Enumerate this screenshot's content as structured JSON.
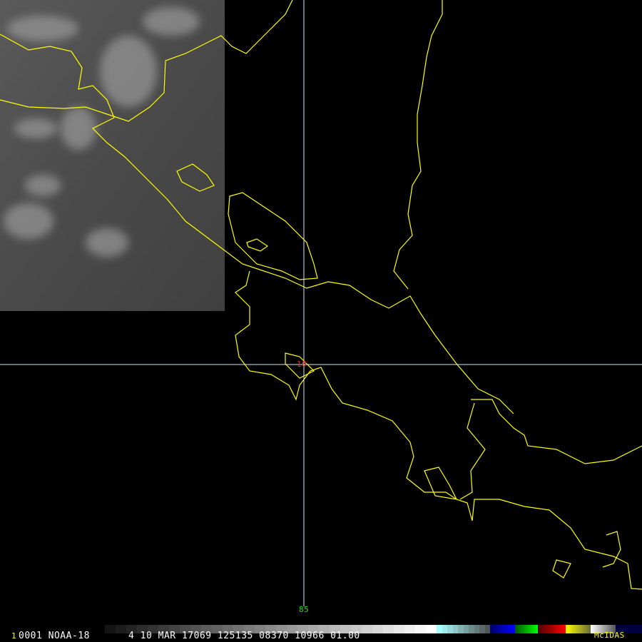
{
  "map": {
    "lat_label": "10",
    "lon_label": "85",
    "crosshair_color": "#cfe8ee",
    "coast_color": "#ffff00",
    "lat_label_color": "#ff2020",
    "lon_label_color": "#20e020"
  },
  "status_bar": {
    "frame": "1",
    "info": "0001 NOAA-18",
    "details": "4 10 MAR 17069 125135 08370 10966 01.00",
    "brand": "McIDAS"
  }
}
